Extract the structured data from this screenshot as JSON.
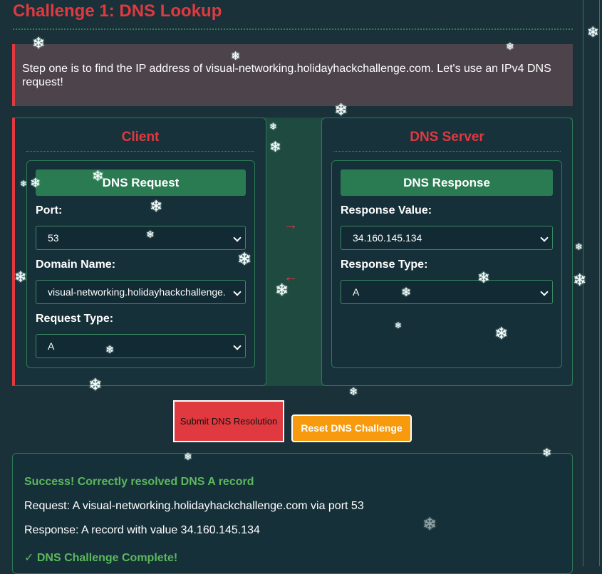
{
  "challenge": {
    "title": "Challenge 1: DNS Lookup",
    "instruction": "Step one is to find the IP address of visual-networking.holidayhackchallenge.com. Let's use an IPv4 DNS request!"
  },
  "client": {
    "title": "Client",
    "card_title": "DNS Request",
    "port_label": "Port:",
    "port_value": "53",
    "domain_label": "Domain Name:",
    "domain_value": "visual-networking.holidayhackchallenge.",
    "request_type_label": "Request Type:",
    "request_type_value": "A"
  },
  "server": {
    "title": "DNS Server",
    "card_title": "DNS Response",
    "response_value_label": "Response Value:",
    "response_value": "34.160.145.134",
    "response_type_label": "Response Type:",
    "response_type_value": "A"
  },
  "arrows": {
    "right": "→",
    "left": "←"
  },
  "buttons": {
    "submit": "Submit DNS Resolution",
    "reset": "Reset DNS Challenge"
  },
  "result": {
    "success": "Success! Correctly resolved DNS A record",
    "request": "Request: A visual-networking.holidayhackchallenge.com via port 53",
    "response": "Response: A record with value 34.160.145.134",
    "complete": "✓ DNS Challenge Complete!"
  },
  "snowflake_glyph": "❄",
  "colors": {
    "accent_red": "#e0393f",
    "green": "#2a7a52",
    "orange": "#f79a0d",
    "background": "#1a3139"
  }
}
